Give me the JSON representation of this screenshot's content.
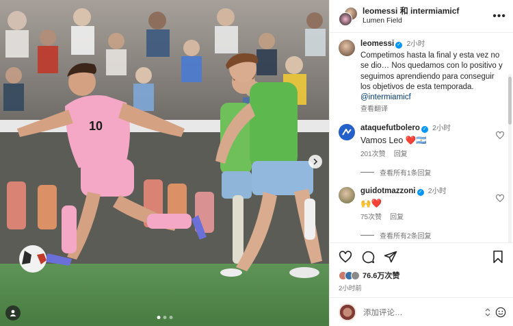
{
  "header": {
    "username": "leomessi 和 intermiamicf",
    "location": "Lumen Field"
  },
  "caption": {
    "username": "leomessi",
    "time": "2小时",
    "text": "Competimos hasta la final y esta vez no se dio… Nos quedamos con lo positivo y seguimos aprendiendo para conseguir los objetivos de esta temporada. ",
    "mention": "@intermiamicf",
    "translate": "查看翻译"
  },
  "comments": [
    {
      "username": "ataquefutbolero",
      "time": "2小时",
      "text": "Vamos Leo ",
      "emoji": "❤️🇦🇷",
      "likes": "201次赞",
      "reply": "回复",
      "view_replies": "查看所有1条回复",
      "avatar_color": "#2360c9"
    },
    {
      "username": "guidotmazzoni",
      "time": "2小时",
      "text": "",
      "emoji": "🙌❤️",
      "likes": "75次赞",
      "reply": "回复",
      "view_replies": "查看所有2条回复",
      "avatar_color": "#6b6a3c"
    }
  ],
  "footer": {
    "likes": "76.6万次赞",
    "post_time": "2小时前",
    "add_comment": "添加评论…"
  },
  "photo": {
    "player_left_number": "10",
    "carousel_dots": 3,
    "active_dot": 0
  },
  "colors": {
    "verified": "#0095f6",
    "like_heart": "#ed4956",
    "link": "#00376b",
    "miami_pink": "#f3a6c4",
    "seattle_green": "#5db84d"
  }
}
